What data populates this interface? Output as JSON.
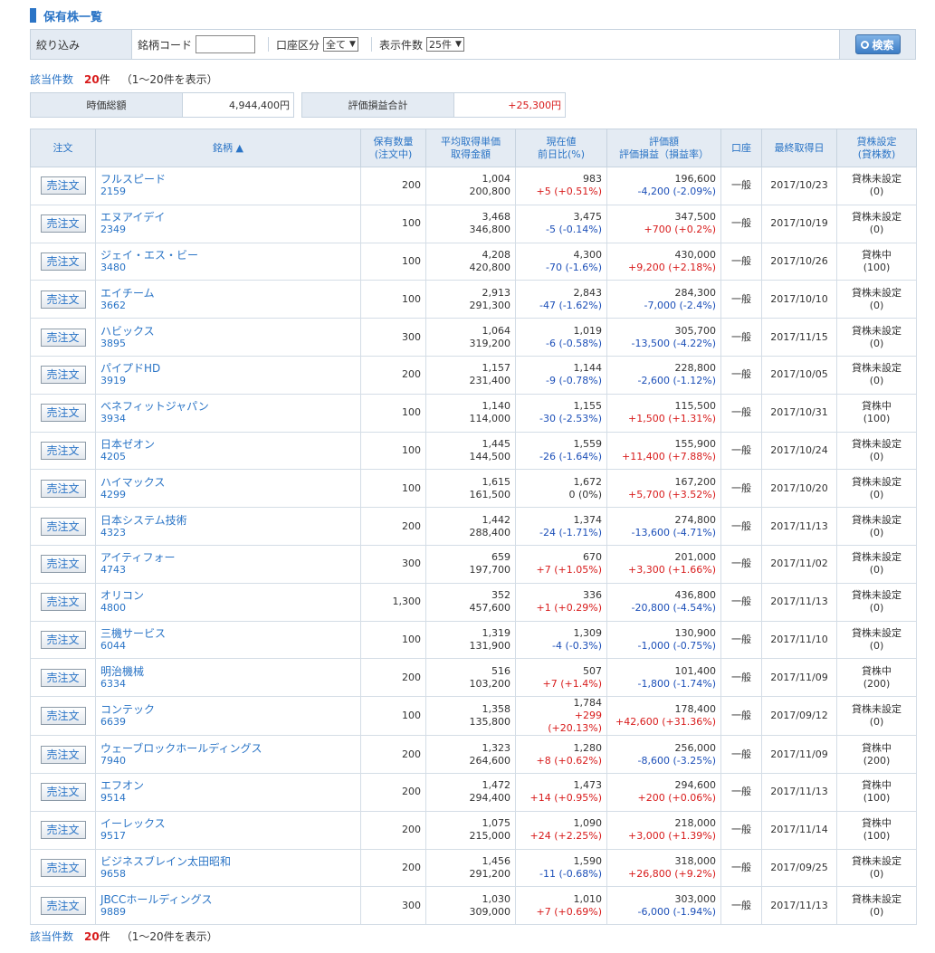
{
  "title": "保有株一覧",
  "filter": {
    "label": "絞り込み",
    "code_label": "銘柄コード",
    "code_value": "",
    "account_label": "口座区分",
    "account_value": "全て",
    "display_label": "表示件数",
    "display_value": "25件",
    "search_label": "検索"
  },
  "count": {
    "label": "該当件数",
    "num": "20",
    "unit": "件",
    "range": "（1～20件を表示）"
  },
  "summary": {
    "market_label": "時価総額",
    "market_value": "4,944,400円",
    "pl_label": "評価損益合計",
    "pl_value": "+25,300円"
  },
  "headers": {
    "order": "注文",
    "name": "銘柄 ▲",
    "qty_1": "保有数量",
    "qty_2": "(注文中)",
    "avg_1": "平均取得単価",
    "avg_2": "取得金額",
    "cur_1": "現在値",
    "cur_2": "前日比(%)",
    "val_1": "評価額",
    "val_2": "評価損益（損益率）",
    "acct": "口座",
    "date": "最終取得日",
    "lend_1": "貸株設定",
    "lend_2": "(貸株数)"
  },
  "sell_label": "売注文",
  "colors": {
    "accent": "#2a74c6",
    "up": "#d81b1b",
    "down": "#1c4fb8",
    "header_bg": "#e4ebf3"
  },
  "rows": [
    {
      "name": "フルスピード",
      "code": "2159",
      "qty": "200",
      "avg": "1,004",
      "cost": "200,800",
      "price": "983",
      "chg": "+5 (+0.51%)",
      "chg_dir": "up",
      "val": "196,600",
      "pl": "-4,200 (-2.09%)",
      "pl_dir": "dn",
      "acct": "一般",
      "date": "2017/10/23",
      "lend": "貸株未設定",
      "lend_qty": "(0)"
    },
    {
      "name": "エヌアイデイ",
      "code": "2349",
      "qty": "100",
      "avg": "3,468",
      "cost": "346,800",
      "price": "3,475",
      "chg": "-5 (-0.14%)",
      "chg_dir": "dn",
      "val": "347,500",
      "pl": "+700 (+0.2%)",
      "pl_dir": "up",
      "acct": "一般",
      "date": "2017/10/19",
      "lend": "貸株未設定",
      "lend_qty": "(0)"
    },
    {
      "name": "ジェイ・エス・ビー",
      "code": "3480",
      "qty": "100",
      "avg": "4,208",
      "cost": "420,800",
      "price": "4,300",
      "chg": "-70 (-1.6%)",
      "chg_dir": "dn",
      "val": "430,000",
      "pl": "+9,200 (+2.18%)",
      "pl_dir": "up",
      "acct": "一般",
      "date": "2017/10/26",
      "lend": "貸株中",
      "lend_qty": "(100)"
    },
    {
      "name": "エイチーム",
      "code": "3662",
      "qty": "100",
      "avg": "2,913",
      "cost": "291,300",
      "price": "2,843",
      "chg": "-47 (-1.62%)",
      "chg_dir": "dn",
      "val": "284,300",
      "pl": "-7,000 (-2.4%)",
      "pl_dir": "dn",
      "acct": "一般",
      "date": "2017/10/10",
      "lend": "貸株未設定",
      "lend_qty": "(0)"
    },
    {
      "name": "ハビックス",
      "code": "3895",
      "qty": "300",
      "avg": "1,064",
      "cost": "319,200",
      "price": "1,019",
      "chg": "-6 (-0.58%)",
      "chg_dir": "dn",
      "val": "305,700",
      "pl": "-13,500 (-4.22%)",
      "pl_dir": "dn",
      "acct": "一般",
      "date": "2017/11/15",
      "lend": "貸株未設定",
      "lend_qty": "(0)"
    },
    {
      "name": "パイプドHD",
      "code": "3919",
      "qty": "200",
      "avg": "1,157",
      "cost": "231,400",
      "price": "1,144",
      "chg": "-9 (-0.78%)",
      "chg_dir": "dn",
      "val": "228,800",
      "pl": "-2,600 (-1.12%)",
      "pl_dir": "dn",
      "acct": "一般",
      "date": "2017/10/05",
      "lend": "貸株未設定",
      "lend_qty": "(0)"
    },
    {
      "name": "ベネフィットジャパン",
      "code": "3934",
      "qty": "100",
      "avg": "1,140",
      "cost": "114,000",
      "price": "1,155",
      "chg": "-30 (-2.53%)",
      "chg_dir": "dn",
      "val": "115,500",
      "pl": "+1,500 (+1.31%)",
      "pl_dir": "up",
      "acct": "一般",
      "date": "2017/10/31",
      "lend": "貸株中",
      "lend_qty": "(100)"
    },
    {
      "name": "日本ゼオン",
      "code": "4205",
      "qty": "100",
      "avg": "1,445",
      "cost": "144,500",
      "price": "1,559",
      "chg": "-26 (-1.64%)",
      "chg_dir": "dn",
      "val": "155,900",
      "pl": "+11,400 (+7.88%)",
      "pl_dir": "up",
      "acct": "一般",
      "date": "2017/10/24",
      "lend": "貸株未設定",
      "lend_qty": "(0)"
    },
    {
      "name": "ハイマックス",
      "code": "4299",
      "qty": "100",
      "avg": "1,615",
      "cost": "161,500",
      "price": "1,672",
      "chg": "0 (0%)",
      "chg_dir": "flat",
      "val": "167,200",
      "pl": "+5,700 (+3.52%)",
      "pl_dir": "up",
      "acct": "一般",
      "date": "2017/10/20",
      "lend": "貸株未設定",
      "lend_qty": "(0)"
    },
    {
      "name": "日本システム技術",
      "code": "4323",
      "qty": "200",
      "avg": "1,442",
      "cost": "288,400",
      "price": "1,374",
      "chg": "-24 (-1.71%)",
      "chg_dir": "dn",
      "val": "274,800",
      "pl": "-13,600 (-4.71%)",
      "pl_dir": "dn",
      "acct": "一般",
      "date": "2017/11/13",
      "lend": "貸株未設定",
      "lend_qty": "(0)"
    },
    {
      "name": "アイティフォー",
      "code": "4743",
      "qty": "300",
      "avg": "659",
      "cost": "197,700",
      "price": "670",
      "chg": "+7 (+1.05%)",
      "chg_dir": "up",
      "val": "201,000",
      "pl": "+3,300 (+1.66%)",
      "pl_dir": "up",
      "acct": "一般",
      "date": "2017/11/02",
      "lend": "貸株未設定",
      "lend_qty": "(0)"
    },
    {
      "name": "オリコン",
      "code": "4800",
      "qty": "1,300",
      "avg": "352",
      "cost": "457,600",
      "price": "336",
      "chg": "+1 (+0.29%)",
      "chg_dir": "up",
      "val": "436,800",
      "pl": "-20,800 (-4.54%)",
      "pl_dir": "dn",
      "acct": "一般",
      "date": "2017/11/13",
      "lend": "貸株未設定",
      "lend_qty": "(0)"
    },
    {
      "name": "三機サービス",
      "code": "6044",
      "qty": "100",
      "avg": "1,319",
      "cost": "131,900",
      "price": "1,309",
      "chg": "-4 (-0.3%)",
      "chg_dir": "dn",
      "val": "130,900",
      "pl": "-1,000 (-0.75%)",
      "pl_dir": "dn",
      "acct": "一般",
      "date": "2017/11/10",
      "lend": "貸株未設定",
      "lend_qty": "(0)"
    },
    {
      "name": "明治機械",
      "code": "6334",
      "qty": "200",
      "avg": "516",
      "cost": "103,200",
      "price": "507",
      "chg": "+7 (+1.4%)",
      "chg_dir": "up",
      "val": "101,400",
      "pl": "-1,800 (-1.74%)",
      "pl_dir": "dn",
      "acct": "一般",
      "date": "2017/11/09",
      "lend": "貸株中",
      "lend_qty": "(200)"
    },
    {
      "name": "コンテック",
      "code": "6639",
      "qty": "100",
      "avg": "1,358",
      "cost": "135,800",
      "price": "1,784",
      "chg": "+299 (+20.13%)",
      "chg_dir": "up",
      "val": "178,400",
      "pl": "+42,600 (+31.36%)",
      "pl_dir": "up",
      "acct": "一般",
      "date": "2017/09/12",
      "lend": "貸株未設定",
      "lend_qty": "(0)"
    },
    {
      "name": "ウェーブロックホールディングス",
      "code": "7940",
      "qty": "200",
      "avg": "1,323",
      "cost": "264,600",
      "price": "1,280",
      "chg": "+8 (+0.62%)",
      "chg_dir": "up",
      "val": "256,000",
      "pl": "-8,600 (-3.25%)",
      "pl_dir": "dn",
      "acct": "一般",
      "date": "2017/11/09",
      "lend": "貸株中",
      "lend_qty": "(200)"
    },
    {
      "name": "エフオン",
      "code": "9514",
      "qty": "200",
      "avg": "1,472",
      "cost": "294,400",
      "price": "1,473",
      "chg": "+14 (+0.95%)",
      "chg_dir": "up",
      "val": "294,600",
      "pl": "+200 (+0.06%)",
      "pl_dir": "up",
      "acct": "一般",
      "date": "2017/11/13",
      "lend": "貸株中",
      "lend_qty": "(100)"
    },
    {
      "name": "イーレックス",
      "code": "9517",
      "qty": "200",
      "avg": "1,075",
      "cost": "215,000",
      "price": "1,090",
      "chg": "+24 (+2.25%)",
      "chg_dir": "up",
      "val": "218,000",
      "pl": "+3,000 (+1.39%)",
      "pl_dir": "up",
      "acct": "一般",
      "date": "2017/11/14",
      "lend": "貸株中",
      "lend_qty": "(100)"
    },
    {
      "name": "ビジネスブレイン太田昭和",
      "code": "9658",
      "qty": "200",
      "avg": "1,456",
      "cost": "291,200",
      "price": "1,590",
      "chg": "-11 (-0.68%)",
      "chg_dir": "dn",
      "val": "318,000",
      "pl": "+26,800 (+9.2%)",
      "pl_dir": "up",
      "acct": "一般",
      "date": "2017/09/25",
      "lend": "貸株未設定",
      "lend_qty": "(0)"
    },
    {
      "name": "JBCCホールディングス",
      "code": "9889",
      "qty": "300",
      "avg": "1,030",
      "cost": "309,000",
      "price": "1,010",
      "chg": "+7 (+0.69%)",
      "chg_dir": "up",
      "val": "303,000",
      "pl": "-6,000 (-1.94%)",
      "pl_dir": "dn",
      "acct": "一般",
      "date": "2017/11/13",
      "lend": "貸株未設定",
      "lend_qty": "(0)"
    }
  ]
}
